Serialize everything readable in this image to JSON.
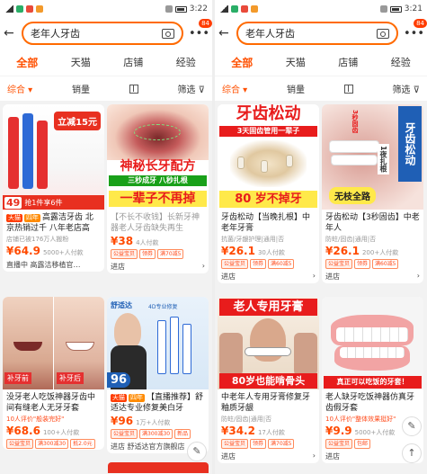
{
  "left": {
    "status": {
      "time": "3:22"
    },
    "search": {
      "query": "老年人牙齿",
      "badge": "84"
    },
    "tabs": [
      "全部",
      "天猫",
      "店铺",
      "经验"
    ],
    "sort": {
      "comprehensive": "综合",
      "sales": "销量",
      "filter": "筛选"
    },
    "cards": [
      {
        "img_text": [
          "立减15元",
          "抢1件享6件"
        ],
        "price_tag": "49",
        "tags": [
          "天猫",
          "四年"
        ],
        "title": "高露洁牙齿 北京热销过千 八年老店高",
        "sub": "店铺已被176万人搬粉",
        "price": "¥64.9",
        "sales": "5000+人付款",
        "coupons": [],
        "shop": "直播中 高露洁移植官…"
      },
      {
        "img_text": [
          "神秘长牙配方",
          "三秒成牙 八秒扎根",
          "一辈子不再掉"
        ],
        "title": "【不长不收钱】长新牙神器老人牙齿缺失再生",
        "sub": "",
        "price": "¥38",
        "sales": "4人付款",
        "coupons": [
          "公益宝贝",
          "领券",
          "满70减5"
        ],
        "shop": "进店"
      },
      {
        "img_text": [
          "补牙前",
          "补牙后"
        ],
        "title": "没牙老人吃饭神器牙齿中间有缝老人无牙牙套",
        "sub": "10人评价\"般装完好\"",
        "price": "¥68.6",
        "sales": "100+人付款",
        "coupons": [
          "公益宝贝",
          "满300减30",
          "抵2.0元"
        ],
        "shop": ""
      },
      {
        "img_text": [
          "舒适达",
          "4D专业修复",
          "96"
        ],
        "tags": [
          "天猫",
          "四年"
        ],
        "title": "【直播推荐】舒适达专业修复美白牙",
        "sub": "",
        "price": "¥96",
        "sales": "1万+人付款",
        "coupons": [
          "公益宝贝",
          "满300减30",
          "新品"
        ],
        "shop": "进店 舒适达官方旗舰店"
      }
    ]
  },
  "right": {
    "status": {
      "time": "3:21"
    },
    "search": {
      "query": "老年人牙齿",
      "badge": "84"
    },
    "tabs": [
      "全部",
      "天猫",
      "店铺",
      "经验"
    ],
    "sort": {
      "comprehensive": "综合",
      "sales": "销量",
      "filter": "筛选"
    },
    "cards": [
      {
        "img_text": [
          "牙齿松动",
          "3天固齿管用一辈子",
          "80 岁不掉牙"
        ],
        "title": "牙齿松动【当晚扎根】中老年牙膏",
        "sub": "抗菌/牙龈护理|通用|否",
        "price": "¥26.1",
        "sales": "30人付款",
        "coupons": [
          "公益宝贝",
          "领券",
          "满60减5"
        ],
        "shop": "进店"
      },
      {
        "img_text": [
          "牙齿松动",
          "3秒固齿",
          "1夜扎根",
          "无枝全路"
        ],
        "title": "牙齿松动【3秒固齿】中老年人",
        "sub": "防蛀/固齿|通用|否",
        "price": "¥26.1",
        "sales": "200+人付款",
        "coupons": [
          "公益宝贝",
          "领券",
          "满60减5"
        ],
        "shop": "进店"
      },
      {
        "img_text": [
          "老人专用牙膏",
          "80岁也能啃骨头"
        ],
        "title": "中老年人专用牙膏修复牙釉质牙龈",
        "sub": "防蛀/固齿|通用|否",
        "price": "¥34.2",
        "sales": "17人付款",
        "coupons": [
          "公益宝贝",
          "领券",
          "满70减5"
        ],
        "shop": "进店"
      },
      {
        "img_text": [
          "真正可以吃饭的牙套！"
        ],
        "title": "老人缺牙吃饭神器仿真牙齿假牙套",
        "sub": "10人评价\"整体效果挺好\"",
        "price": "¥9.9",
        "sales": "5000+人付款",
        "coupons": [
          "公益宝贝",
          "包邮"
        ],
        "shop": "进店"
      }
    ]
  },
  "colors": {
    "accent": "#ff5000",
    "price": "#ff4a00"
  }
}
